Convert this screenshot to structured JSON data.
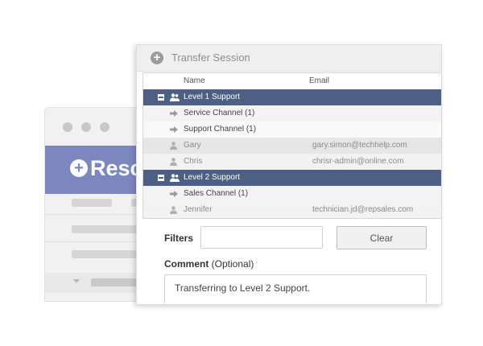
{
  "brand": {
    "name": "Resc"
  },
  "dialog": {
    "title": "Transfer Session",
    "columns": {
      "name": "Name",
      "email": "Email"
    },
    "groups": [
      {
        "label": "Level 1 Support",
        "channels": [
          "Service Channel (1)",
          "Support Channel (1)"
        ],
        "users": [
          {
            "name": "Gary",
            "email": "gary.simon@techhelp.com"
          },
          {
            "name": "Chris",
            "email": "chrisr-admin@online.com"
          }
        ]
      },
      {
        "label": "Level 2 Support",
        "channels": [
          "Sales Channel (1)"
        ],
        "users": [
          {
            "name": "Jennifer",
            "email": "technician.jd@repsales.com"
          }
        ]
      }
    ],
    "filters": {
      "label": "Filters",
      "value": ""
    },
    "clear_label": "Clear",
    "comment": {
      "label": "Comment",
      "optional": " (Optional)",
      "value": "Transferring to Level 2 Support."
    }
  },
  "colors": {
    "brand": "#7c87bf",
    "group_row": "#4d5f84"
  }
}
